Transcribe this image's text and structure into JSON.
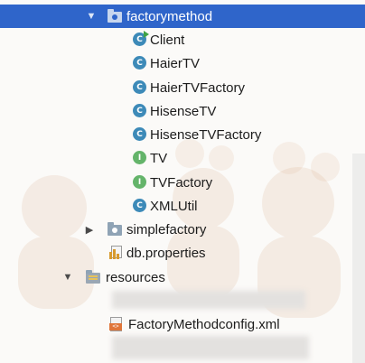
{
  "tree": {
    "package_name": "factorymethod",
    "classes": [
      {
        "label": "Client",
        "kind": "class",
        "badge": "C",
        "runnable": true
      },
      {
        "label": "HaierTV",
        "kind": "class",
        "badge": "C"
      },
      {
        "label": "HaierTVFactory",
        "kind": "class",
        "badge": "C"
      },
      {
        "label": "HisenseTV",
        "kind": "class",
        "badge": "C"
      },
      {
        "label": "HisenseTVFactory",
        "kind": "class",
        "badge": "C"
      },
      {
        "label": "TV",
        "kind": "interface",
        "badge": "I"
      },
      {
        "label": "TVFactory",
        "kind": "interface",
        "badge": "I"
      },
      {
        "label": "XMLUtil",
        "kind": "class",
        "badge": "C"
      }
    ],
    "simplefactory_label": "simplefactory",
    "db_properties_label": "db.properties",
    "resources_label": "resources",
    "xml_file_label": "FactoryMethodconfig.xml"
  },
  "colors": {
    "selection": "#2f65ca",
    "class_badge": "#3d8ab8",
    "interface_badge": "#64b46a"
  },
  "icons": {
    "expanded": "▼",
    "collapsed": "▶"
  }
}
